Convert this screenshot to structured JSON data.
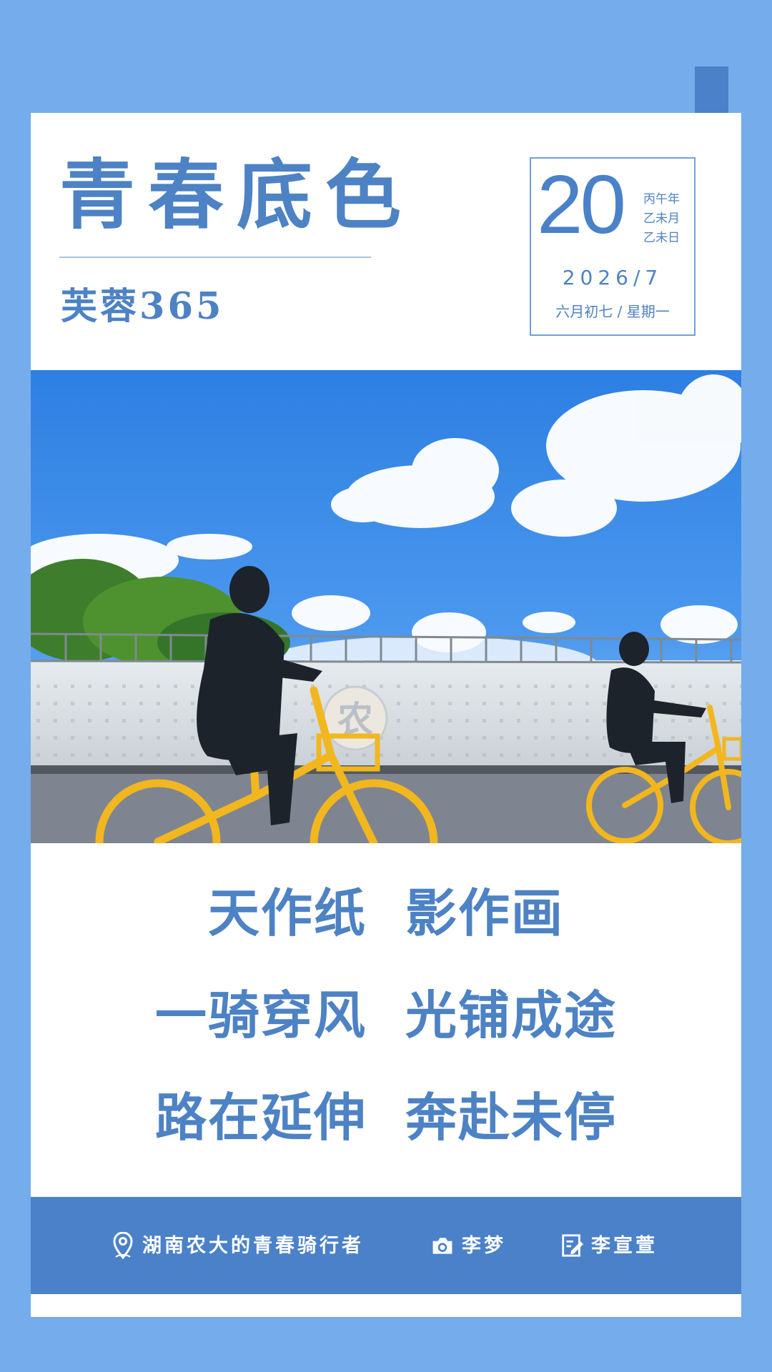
{
  "header": {
    "title": "青春底色",
    "brand": "芙蓉365"
  },
  "date": {
    "day": "20",
    "meta": [
      "丙午年",
      "乙未月",
      "乙未日"
    ],
    "year_month": "2026/7",
    "lunar_weekday": "六月初七 / 星期一"
  },
  "photo": {
    "wall_character": "农"
  },
  "poem": [
    [
      "天作纸",
      "影作画"
    ],
    [
      "一骑穿风",
      "光铺成途"
    ],
    [
      "路在延伸",
      "奔赴未停"
    ]
  ],
  "footer": {
    "location": "湖南农大的青春骑行者",
    "photographer": "李梦",
    "writer": "李宣萱"
  },
  "icons": {
    "location": "location-pin-icon",
    "photographer": "camera-icon",
    "writer": "edit-note-icon"
  },
  "colors": {
    "frame": "#75aceb",
    "accent": "#4a81c9",
    "text": "#4d82c4",
    "paper": "#ffffff",
    "bike": "#f2b71f"
  }
}
